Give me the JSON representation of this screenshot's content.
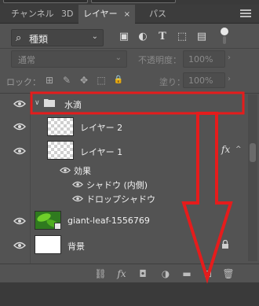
{
  "tabs": [
    {
      "label": "チャンネル"
    },
    {
      "label": "3D"
    },
    {
      "label": "レイヤー",
      "active": true,
      "close": "×"
    },
    {
      "label": "パス"
    }
  ],
  "filter": {
    "icon": "search-icon",
    "label": "種類"
  },
  "filter_icons": [
    "image-filter-icon",
    "adjustment-filter-icon",
    "text-filter-icon",
    "shape-filter-icon",
    "smart-object-filter-icon"
  ],
  "filter_icon_glyphs": [
    "▣",
    "◐",
    "T",
    "⬚",
    "▤"
  ],
  "blend_mode": "通常",
  "opacity": {
    "label": "不透明度：",
    "value": "100%"
  },
  "lock": {
    "label": "ロック："
  },
  "lock_icons": [
    "⊞",
    "✎",
    "✥",
    "⬚",
    "🔒"
  ],
  "fill": {
    "label": "塗り：",
    "value": "100%"
  },
  "layers": [
    {
      "type": "group",
      "name": "水滴",
      "expanded": true
    },
    {
      "type": "layer",
      "name": "レイヤー 2"
    },
    {
      "type": "layer",
      "name": "レイヤー 1",
      "fx": "fx"
    },
    {
      "type": "effects",
      "name": "効果"
    },
    {
      "type": "effect",
      "name": "シャドウ (内側)"
    },
    {
      "type": "effect",
      "name": "ドロップシャドウ"
    },
    {
      "type": "smart",
      "name": "giant-leaf-1556769"
    },
    {
      "type": "background",
      "name": "背景"
    }
  ],
  "bottom_icons": [
    "link-icon",
    "fx-icon",
    "mask-icon",
    "adjustment-icon",
    "folder-icon",
    "new-layer-icon",
    "trash-icon"
  ],
  "bottom_icon_glyphs": [
    "⛓",
    "fx",
    "◘",
    "◑",
    "▬",
    "⊡",
    "🗑"
  ],
  "colors": {
    "annotation": "#e51c1c",
    "panel": "#535353"
  }
}
